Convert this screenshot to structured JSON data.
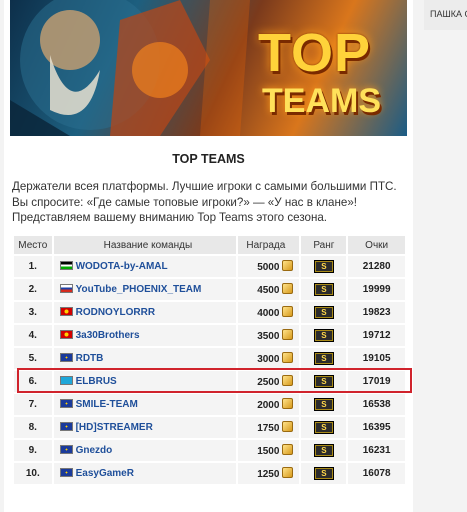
{
  "side": {
    "text": "ПАШКА С"
  },
  "banner": {
    "line1": "TOP",
    "line2": "TEAMS"
  },
  "title": "TOP TEAMS",
  "description": "Держатели всея платформы. Лучшие игроки с самыми большими ПТС. Вы спросите: «Где самые топовые игроки?» — «У нас в клане»! Представляем вашему вниманию Top Teams этого сезона.",
  "table": {
    "headers": [
      "Место",
      "Название команды",
      "Награда",
      "Ранг",
      "Очки"
    ],
    "rows": [
      {
        "place": "1.",
        "team": "WODOTA-by-AMAL",
        "prize": "5000",
        "rank": "S",
        "points": "21280",
        "flag": "af"
      },
      {
        "place": "2.",
        "team": "YouTube_PHOENIX_TEAM",
        "prize": "4500",
        "rank": "S",
        "points": "19999",
        "flag": "ru"
      },
      {
        "place": "3.",
        "team": "RODNOYLORRR",
        "prize": "4000",
        "rank": "S",
        "points": "19823",
        "flag": "mk"
      },
      {
        "place": "4.",
        "team": "3a30Brothers",
        "prize": "3500",
        "rank": "S",
        "points": "19712",
        "flag": "mk"
      },
      {
        "place": "5.",
        "team": "RDTB",
        "prize": "3000",
        "rank": "S",
        "points": "19105",
        "flag": "eu"
      },
      {
        "place": "6.",
        "team": "ELBRUS",
        "prize": "2500",
        "rank": "S",
        "points": "17019",
        "flag": "kz"
      },
      {
        "place": "7.",
        "team": "SMILE-TEAM",
        "prize": "2000",
        "rank": "S",
        "points": "16538",
        "flag": "eu"
      },
      {
        "place": "8.",
        "team": "[HD]STREAMER",
        "prize": "1750",
        "rank": "S",
        "points": "16395",
        "flag": "eu"
      },
      {
        "place": "9.",
        "team": "Gnezdo",
        "prize": "1500",
        "rank": "S",
        "points": "16231",
        "flag": "eu"
      },
      {
        "place": "10.",
        "team": "EasyGameR",
        "prize": "1250",
        "rank": "S",
        "points": "16078",
        "flag": "eu"
      }
    ],
    "highlighted_row": 6
  },
  "colors": {
    "link": "#1f4f9a",
    "highlight": "#d0232c",
    "coin": "#e0a42a",
    "badge": "#2b2b2b"
  },
  "icons": {
    "coin": "gold-coins-icon",
    "rank": "rank-badge-icon",
    "flag": "country-flag-icon"
  }
}
